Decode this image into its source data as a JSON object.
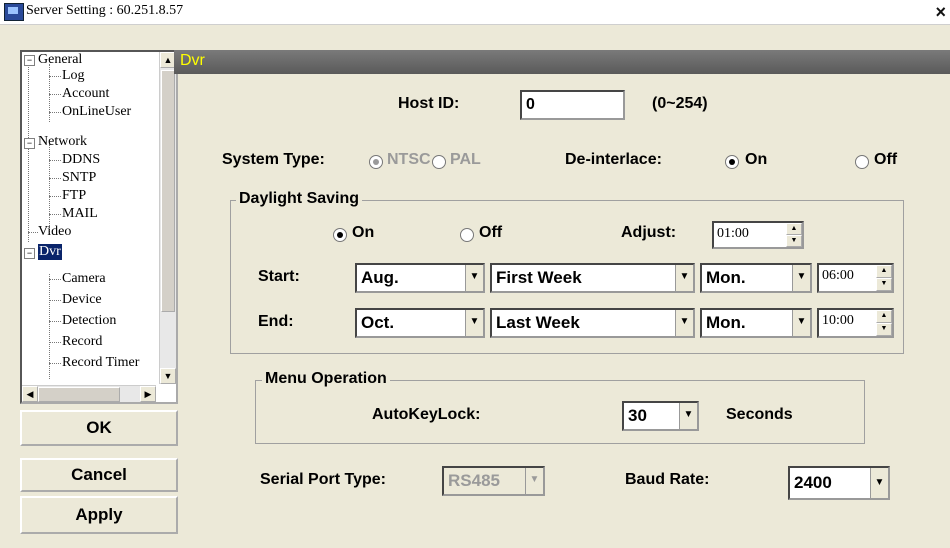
{
  "window": {
    "title": "Server Setting : 60.251.8.57",
    "close_label": "×"
  },
  "tree": {
    "general": "General",
    "log": "Log",
    "account": "Account",
    "onlineuser": "OnLineUser",
    "network": "Network",
    "ddns": "DDNS",
    "sntp": "SNTP",
    "ftp": "FTP",
    "mail": "MAIL",
    "video": "Video",
    "dvr": "Dvr",
    "camera": "Camera",
    "device": "Device",
    "detection": "Detection",
    "record": "Record",
    "record_timer": "Record Timer"
  },
  "buttons": {
    "ok": "OK",
    "cancel": "Cancel",
    "apply": "Apply"
  },
  "panel": {
    "title": "Dvr"
  },
  "host": {
    "label": "Host ID:",
    "value": "0",
    "range": "(0~254)"
  },
  "system_type": {
    "label": "System Type:",
    "ntsc": "NTSC",
    "pal": "PAL",
    "selected": "NTSC",
    "enabled": false
  },
  "deinterlace": {
    "label": "De-interlace:",
    "on": "On",
    "off": "Off",
    "selected": "On"
  },
  "daylight": {
    "title": "Daylight Saving",
    "on": "On",
    "off": "Off",
    "selected": "On",
    "adjust_label": "Adjust:",
    "adjust_value": "01:00",
    "start_label": "Start:",
    "start_month": "Aug.",
    "start_week": "First Week",
    "start_day": "Mon.",
    "start_time": "06:00",
    "end_label": "End:",
    "end_month": "Oct.",
    "end_week": "Last Week",
    "end_day": "Mon.",
    "end_time": "10:00"
  },
  "menu_operation": {
    "title": "Menu Operation",
    "autokeylock_label": "AutoKeyLock:",
    "autokeylock_value": "30",
    "seconds_label": "Seconds"
  },
  "serial": {
    "label": "Serial Port Type:",
    "value": "RS485",
    "enabled": false
  },
  "baud": {
    "label": "Baud Rate:",
    "value": "2400"
  },
  "icons": {
    "app": "server-setting-app-icon",
    "expand": "tree-collapse-icon",
    "dropdown": "chevron-down-icon",
    "spin_up": "spin-up-icon",
    "spin_down": "spin-down-icon"
  }
}
